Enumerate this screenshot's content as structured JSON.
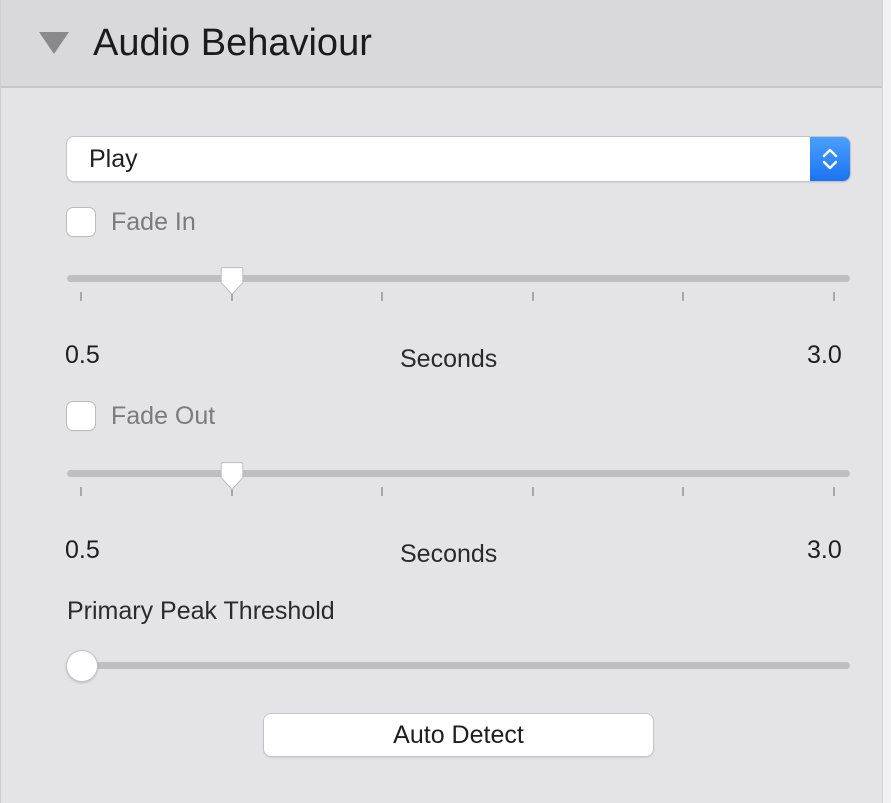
{
  "section": {
    "title": "Audio Behaviour"
  },
  "action_select": {
    "value": "Play"
  },
  "fade_in": {
    "checkbox_label": "Fade In",
    "checked": false,
    "slider": {
      "min_label": "0.5",
      "max_label": "3.0",
      "units_label": "Seconds",
      "min": 0.5,
      "max": 3.0,
      "value": 1.0,
      "tick_count": 6
    }
  },
  "fade_out": {
    "checkbox_label": "Fade Out",
    "checked": false,
    "slider": {
      "min_label": "0.5",
      "max_label": "3.0",
      "units_label": "Seconds",
      "min": 0.5,
      "max": 3.0,
      "value": 1.0,
      "tick_count": 6
    }
  },
  "peak_threshold": {
    "label": "Primary Peak Threshold",
    "fraction": 0.0
  },
  "auto_detect_button": {
    "label": "Auto Detect"
  },
  "colors": {
    "accent": "#1c73f0",
    "panel_background": "#e4e4e7",
    "header_background": "#d9d9dc"
  },
  "icons": {
    "disclosure": "disclosure-triangle-down-icon",
    "select_stepper": "up-down-chevron-icon"
  }
}
